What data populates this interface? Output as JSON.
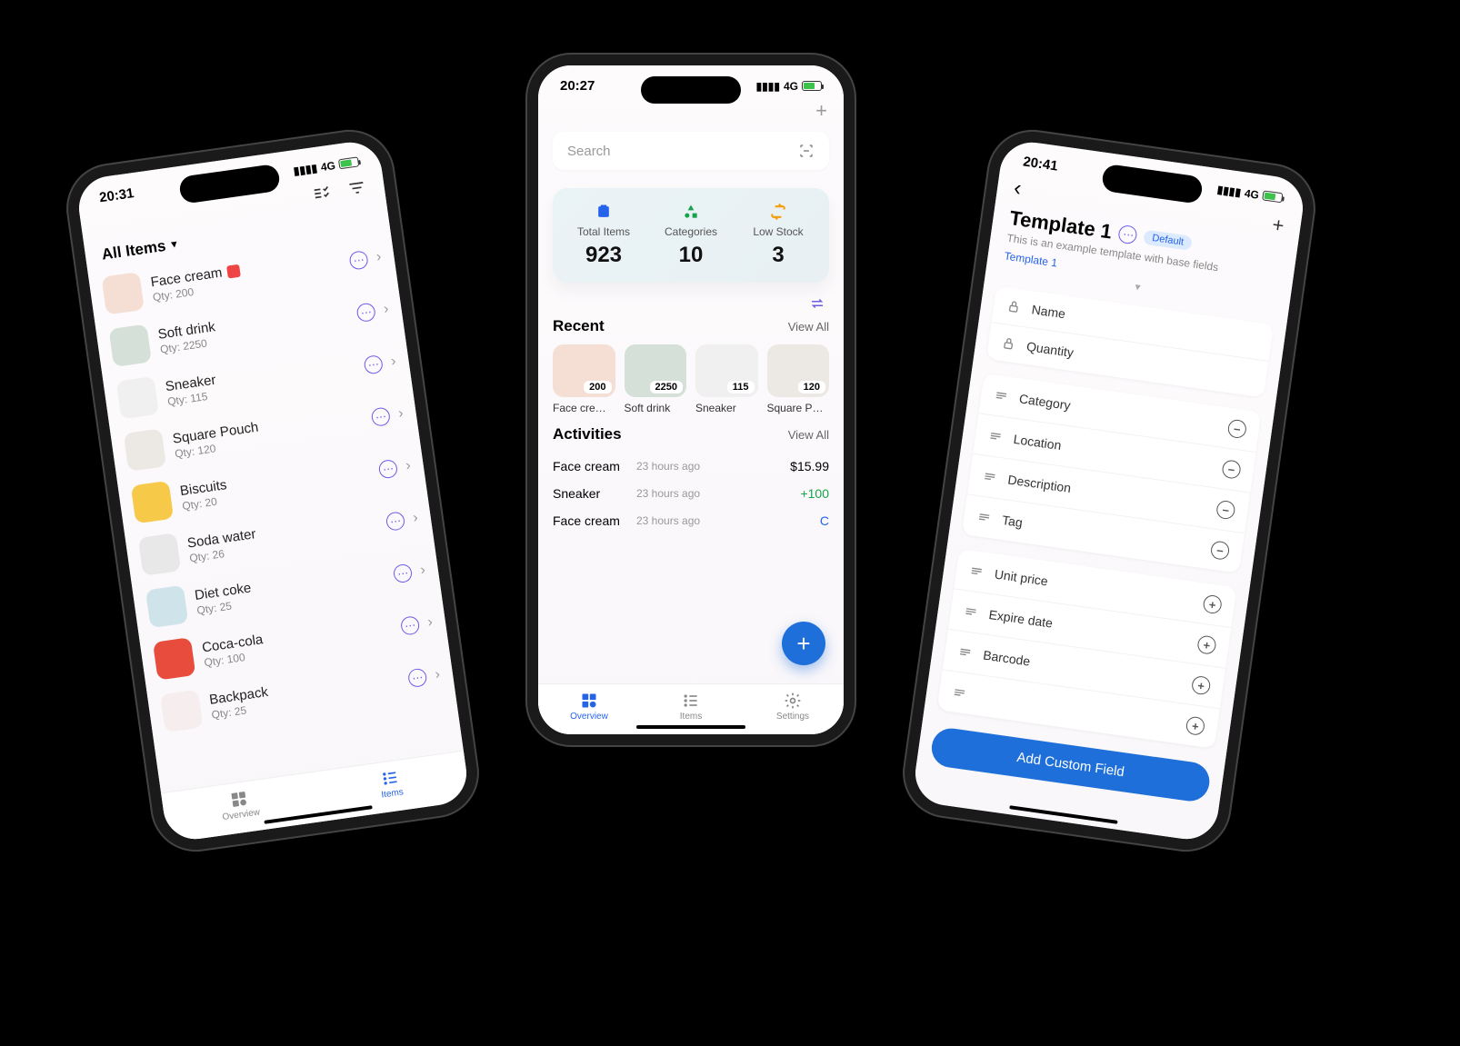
{
  "left": {
    "time": "20:31",
    "signal": "4G",
    "filter_label": "All Items",
    "items": [
      {
        "name": "Face cream",
        "qty": "Qty: 200",
        "has_date": true,
        "thumb_bg": "#f5ded4"
      },
      {
        "name": "Soft drink",
        "qty": "Qty: 2250",
        "thumb_bg": "#d4e0d8"
      },
      {
        "name": "Sneaker",
        "qty": "Qty: 115",
        "thumb_bg": "#f0f0f0"
      },
      {
        "name": "Square Pouch",
        "qty": "Qty: 120",
        "thumb_bg": "#ece8e3"
      },
      {
        "name": "Biscuits",
        "qty": "Qty: 20",
        "thumb_bg": "#f7c948"
      },
      {
        "name": "Soda water",
        "qty": "Qty: 26",
        "thumb_bg": "#e8e8e8"
      },
      {
        "name": "Diet coke",
        "qty": "Qty: 25",
        "thumb_bg": "#cfe4ea"
      },
      {
        "name": "Coca-cola",
        "qty": "Qty: 100",
        "thumb_bg": "#e74c3c"
      },
      {
        "name": "Backpack",
        "qty": "Qty: 25",
        "thumb_bg": "#f6eeee"
      }
    ],
    "nav": {
      "overview": "Overview",
      "items": "Items"
    }
  },
  "center": {
    "time": "20:27",
    "signal": "4G",
    "search_placeholder": "Search",
    "stats": [
      {
        "label": "Total Items",
        "value": "923",
        "icon": "box",
        "color": "#2563eb"
      },
      {
        "label": "Categories",
        "value": "10",
        "icon": "shapes",
        "color": "#16a34a"
      },
      {
        "label": "Low Stock",
        "value": "3",
        "icon": "loop",
        "color": "#f59e0b"
      }
    ],
    "recent_title": "Recent",
    "view_all": "View All",
    "recent": [
      {
        "name": "Face cre…",
        "qty": "200",
        "bg": "#f5ded4"
      },
      {
        "name": "Soft drink",
        "qty": "2250",
        "bg": "#d4e0d8"
      },
      {
        "name": "Sneaker",
        "qty": "115",
        "bg": "#f0f0f0"
      },
      {
        "name": "Square P…",
        "qty": "120",
        "bg": "#ece8e3"
      }
    ],
    "activities_title": "Activities",
    "activities": [
      {
        "name": "Face cream",
        "time": "23 hours ago",
        "value": "$15.99",
        "cls": ""
      },
      {
        "name": "Sneaker",
        "time": "23 hours ago",
        "value": "+100",
        "cls": "green"
      },
      {
        "name": "Face cream",
        "time": "23 hours ago",
        "value": "C",
        "cls": "blue"
      }
    ],
    "nav": {
      "overview": "Overview",
      "items": "Items",
      "settings": "Settings"
    }
  },
  "right": {
    "time": "20:41",
    "signal": "4G",
    "title": "Template 1",
    "default_label": "Default",
    "desc": "This is an example template with base fields",
    "crumb": "Template 1",
    "locked_fields": [
      {
        "name": "Name"
      },
      {
        "name": "Quantity"
      }
    ],
    "removable_fields": [
      {
        "name": "Category"
      },
      {
        "name": "Location"
      },
      {
        "name": "Description"
      },
      {
        "name": "Tag"
      }
    ],
    "addable_fields": [
      {
        "name": "Unit price"
      },
      {
        "name": "Expire date"
      },
      {
        "name": "Barcode"
      },
      {
        "name": ""
      }
    ],
    "add_button": "Add Custom Field"
  }
}
